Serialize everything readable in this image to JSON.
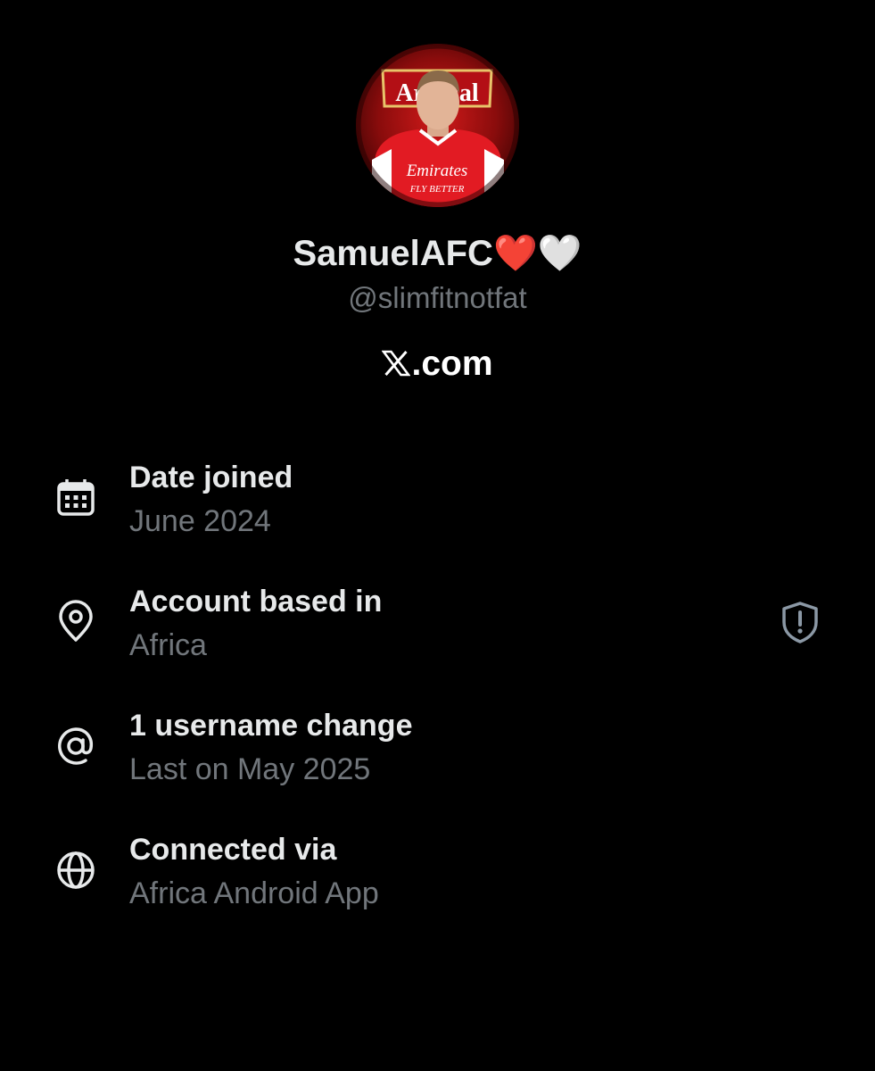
{
  "profile": {
    "display_name": "SamuelAFC",
    "name_emoji_1": "❤️",
    "name_emoji_2": "🤍",
    "handle": "@slimfitnotfat",
    "avatar_text": {
      "badge": "Arsenal",
      "sponsor": "Emirates",
      "slogan": "FLY BETTER"
    }
  },
  "platform": {
    "domain": ".com",
    "logo_icon": "x-logo-icon"
  },
  "info_rows": [
    {
      "icon": "calendar-icon",
      "title": "Date joined",
      "value": "June 2024"
    },
    {
      "icon": "location-pin-icon",
      "title": "Account based in",
      "value": "Africa",
      "action_icon": "shield-alert-icon"
    },
    {
      "icon": "at-sign-icon",
      "title": "1 username change",
      "value": "Last on May 2025"
    },
    {
      "icon": "globe-icon",
      "title": "Connected via",
      "value": "Africa Android App"
    }
  ],
  "colors": {
    "background": "#000000",
    "primary_text": "#e7e9ea",
    "secondary_text": "#71767b",
    "avatar_red": "#c8102e"
  }
}
